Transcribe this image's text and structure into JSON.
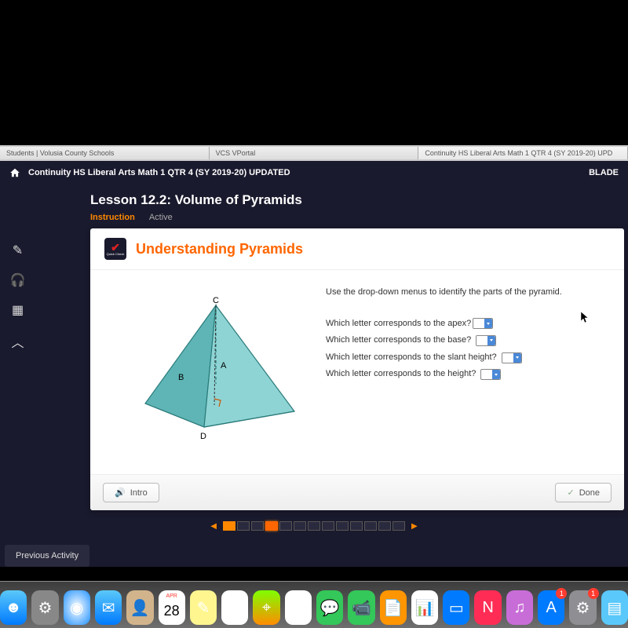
{
  "browser": {
    "tabs": [
      "Students | Volusia County Schools",
      "VCS VPortal",
      "Continuity HS Liberal Arts Math 1 QTR 4 (SY 2019-20) UPD"
    ]
  },
  "course": {
    "title": "Continuity HS Liberal Arts Math 1 QTR 4 (SY 2019-20) UPDATED",
    "user": "BLADE"
  },
  "lesson": {
    "title": "Lesson 12.2: Volume of Pyramids",
    "tabs": {
      "active": "Instruction",
      "inactive": "Active"
    }
  },
  "panel": {
    "badge_label": "Quick Check",
    "title": "Understanding Pyramids",
    "figure_labels": {
      "apex": "C",
      "height": "A",
      "slant": "B",
      "base": "D"
    },
    "intro": "Use the drop-down menus to identify the parts of the pyramid.",
    "questions": [
      "Which letter corresponds to the apex?",
      "Which letter corresponds to the base?",
      "Which letter corresponds to the slant height?",
      "Which letter corresponds to the height?"
    ],
    "footer": {
      "intro": "Intro",
      "done": "Done"
    }
  },
  "prev_activity": "Previous Activity",
  "dock": {
    "items": [
      {
        "name": "finder",
        "color": "linear-gradient(#5ac8fa,#007aff)",
        "glyph": "☻"
      },
      {
        "name": "launchpad",
        "color": "#888",
        "glyph": "⚙"
      },
      {
        "name": "safari",
        "color": "radial-gradient(#fff,#1e90ff)",
        "glyph": "◉"
      },
      {
        "name": "mail",
        "color": "linear-gradient(#5ac8fa,#007aff)",
        "glyph": "✉"
      },
      {
        "name": "contacts",
        "color": "#d2b48c",
        "glyph": "👤"
      },
      {
        "name": "calendar",
        "color": "#fff",
        "glyph": "28",
        "text": "APR"
      },
      {
        "name": "notes",
        "color": "#fff68f",
        "glyph": "✎"
      },
      {
        "name": "reminders",
        "color": "#fff",
        "glyph": "☑"
      },
      {
        "name": "maps",
        "color": "linear-gradient(#7fff00,#ff8c00)",
        "glyph": "⌖"
      },
      {
        "name": "photos",
        "color": "#fff",
        "glyph": "❀"
      },
      {
        "name": "messages",
        "color": "#34c759",
        "glyph": "💬"
      },
      {
        "name": "facetime",
        "color": "#34c759",
        "glyph": "📹"
      },
      {
        "name": "pages",
        "color": "#ff9500",
        "glyph": "📄"
      },
      {
        "name": "numbers",
        "color": "#fff",
        "glyph": "📊"
      },
      {
        "name": "keynote",
        "color": "#007aff",
        "glyph": "▭"
      },
      {
        "name": "news",
        "color": "#ff2d55",
        "glyph": "N"
      },
      {
        "name": "itunes",
        "color": "#c86dd7",
        "glyph": "♫"
      },
      {
        "name": "appstore",
        "color": "#007aff",
        "glyph": "A",
        "badge": "1"
      },
      {
        "name": "settings",
        "color": "#8e8e93",
        "glyph": "⚙",
        "badge": "1"
      },
      {
        "name": "other",
        "color": "#5ac8fa",
        "glyph": "▤"
      }
    ]
  }
}
